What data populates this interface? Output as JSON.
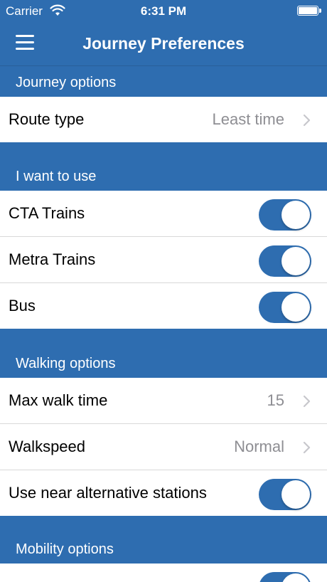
{
  "status_bar": {
    "carrier": "Carrier",
    "time": "6:31 PM"
  },
  "nav": {
    "title": "Journey Preferences",
    "menu_icon": "hamburger-menu-icon"
  },
  "sections": {
    "journey_options": {
      "header": "Journey options",
      "route_type": {
        "label": "Route type",
        "value": "Least time"
      }
    },
    "use": {
      "header": "I want to use",
      "cta_trains": {
        "label": "CTA Trains",
        "on": true
      },
      "metra_trains": {
        "label": "Metra Trains",
        "on": true
      },
      "bus": {
        "label": "Bus",
        "on": true
      }
    },
    "walking": {
      "header": "Walking options",
      "max_walk_time": {
        "label": "Max walk time",
        "value": "15"
      },
      "walkspeed": {
        "label": "Walkspeed",
        "value": "Normal"
      },
      "near_alt_stations": {
        "label": "Use near alternative stations",
        "on": true
      }
    },
    "mobility": {
      "header": "Mobility options"
    }
  },
  "colors": {
    "brand_blue": "#2e6db0",
    "value_gray": "#8e8e93",
    "row_white": "#ffffff"
  }
}
